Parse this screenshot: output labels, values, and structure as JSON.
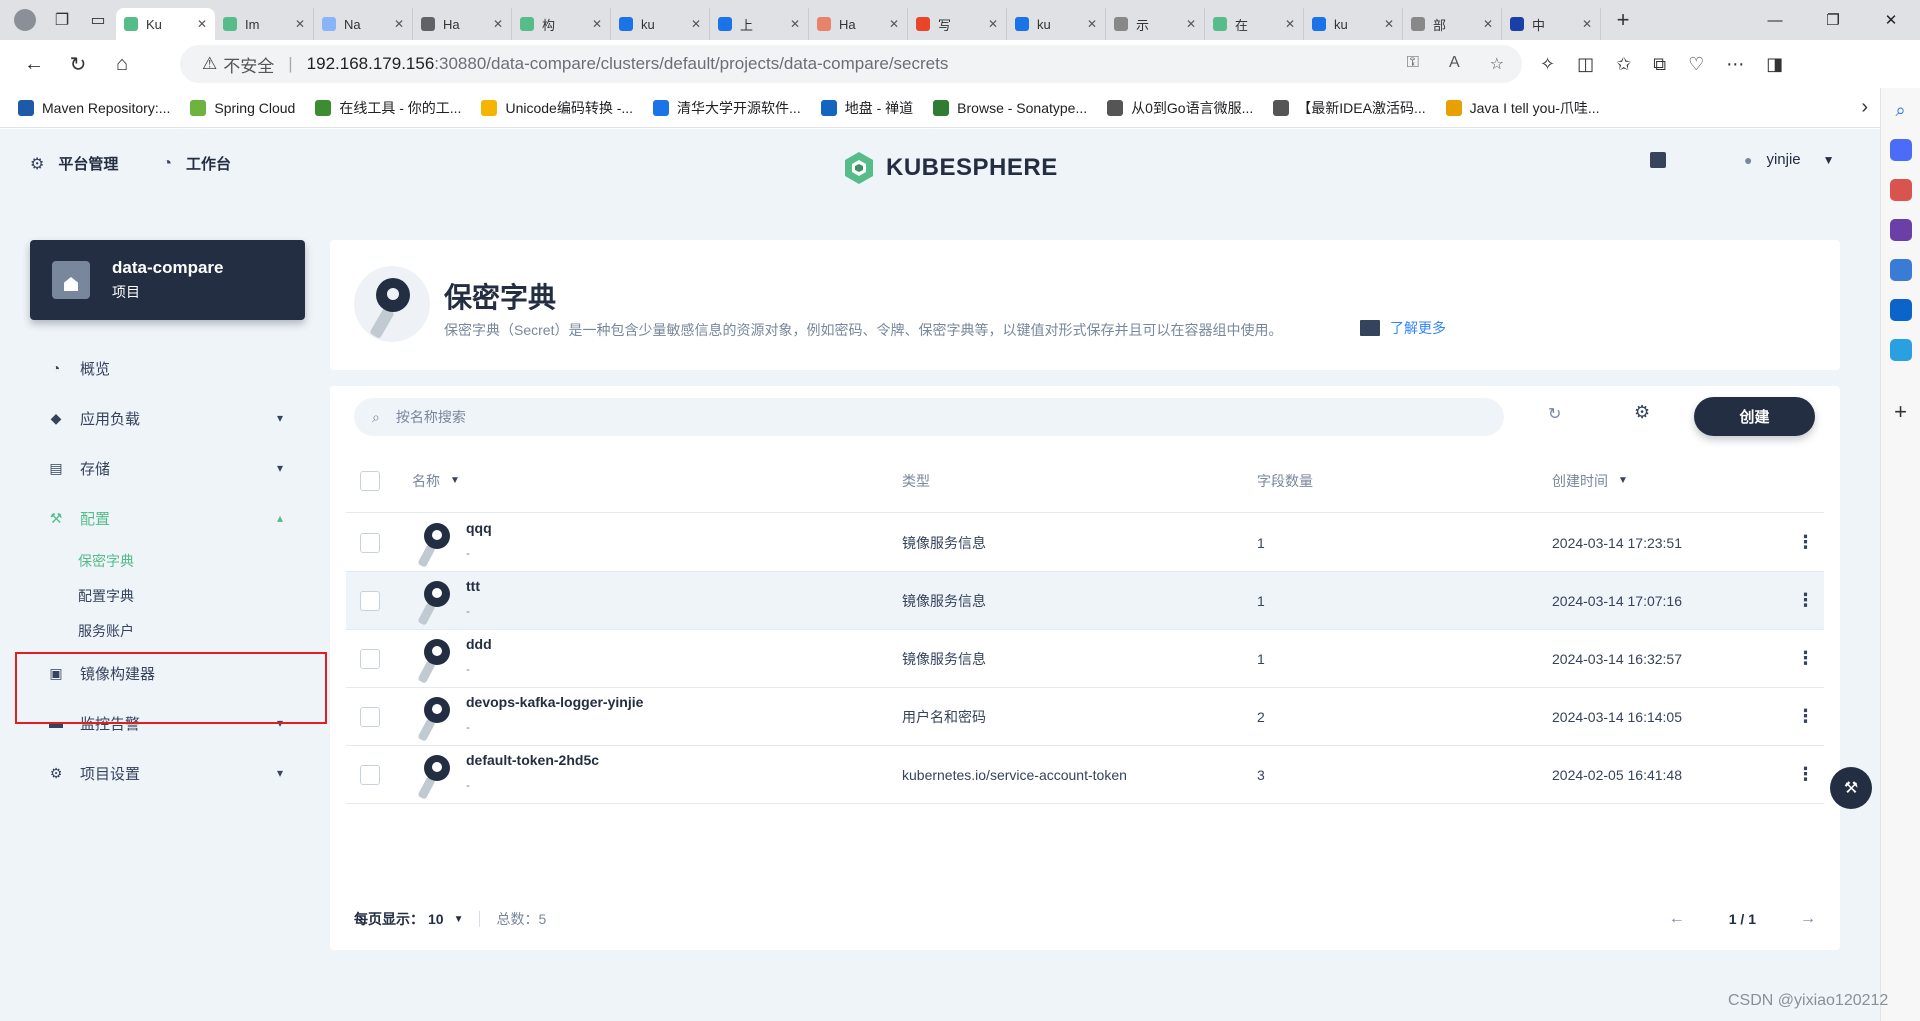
{
  "browser": {
    "tabs": [
      {
        "title": "Ku",
        "color": "#55bc8a",
        "active": true
      },
      {
        "title": "Im",
        "color": "#55bc8a",
        "active": false
      },
      {
        "title": "Na",
        "color": "#8ab4f8",
        "active": false
      },
      {
        "title": "Ha",
        "color": "#5f6368",
        "active": false
      },
      {
        "title": "构",
        "color": "#55bc8a",
        "active": false
      },
      {
        "title": "ku",
        "color": "#1a73e8",
        "active": false
      },
      {
        "title": "上",
        "color": "#1a73e8",
        "active": false
      },
      {
        "title": "Ha",
        "color": "#e8826a",
        "active": false
      },
      {
        "title": "写",
        "color": "#e8452a",
        "active": false
      },
      {
        "title": "ku",
        "color": "#1a73e8",
        "active": false
      },
      {
        "title": "示",
        "color": "#888888",
        "active": false
      },
      {
        "title": "在",
        "color": "#55bc8a",
        "active": false
      },
      {
        "title": "ku",
        "color": "#1a73e8",
        "active": false
      },
      {
        "title": "部",
        "color": "#888888",
        "active": false
      },
      {
        "title": "中",
        "color": "#1a3fa8",
        "active": false
      }
    ],
    "address": {
      "warning_label": "不安全",
      "host": "192.168.179.156",
      "path": ":30880/data-compare/clusters/default/projects/data-compare/secrets"
    },
    "bookmarks": [
      {
        "label": "Maven Repository:...",
        "color": "#1e5aa8"
      },
      {
        "label": "Spring Cloud",
        "color": "#6db33f"
      },
      {
        "label": "在线工具 - 你的工...",
        "color": "#3c8d2f"
      },
      {
        "label": "Unicode编码转换 -...",
        "color": "#f4b400"
      },
      {
        "label": "清华大学开源软件...",
        "color": "#1a73e8"
      },
      {
        "label": "地盘 - 禅道",
        "color": "#1565c0"
      },
      {
        "label": "Browse - Sonatype...",
        "color": "#2e7d32"
      },
      {
        "label": "从0到Go语言微服...",
        "color": "#555555"
      },
      {
        "label": "【最新IDEA激活码...",
        "color": "#555555"
      },
      {
        "label": "Java I tell you-爪哇...",
        "color": "#e8a000"
      }
    ]
  },
  "app": {
    "topnav": {
      "platform": "平台管理",
      "workbench": "工作台"
    },
    "logo_text": "KUBESPHERE",
    "user": "yinjie",
    "project": {
      "name": "data-compare",
      "type": "项目"
    },
    "menu": {
      "overview": "概览",
      "workloads": "应用负载",
      "storage": "存储",
      "config": "配置",
      "secrets": "保密字典",
      "configmaps": "配置字典",
      "service_accounts": "服务账户",
      "image_builder": "镜像构建器",
      "monitoring": "监控告警",
      "project_settings": "项目设置"
    },
    "banner": {
      "title": "保密字典",
      "description": "保密字典（Secret）是一种包含少量敏感信息的资源对象，例如密码、令牌、保密字典等，以键值对形式保存并且可以在容器组中使用。",
      "learn_more": "了解更多"
    },
    "toolbar": {
      "search_placeholder": "按名称搜索",
      "create": "创建"
    },
    "table": {
      "headers": {
        "name": "名称",
        "type": "类型",
        "field_count": "字段数量",
        "created": "创建时间"
      },
      "rows": [
        {
          "name": "qqq",
          "desc": "-",
          "type": "镜像服务信息",
          "count": "1",
          "created": "2024-03-14 17:23:51"
        },
        {
          "name": "ttt",
          "desc": "-",
          "type": "镜像服务信息",
          "count": "1",
          "created": "2024-03-14 17:07:16"
        },
        {
          "name": "ddd",
          "desc": "-",
          "type": "镜像服务信息",
          "count": "1",
          "created": "2024-03-14 16:32:57"
        },
        {
          "name": "devops-kafka-logger-yinjie",
          "desc": "-",
          "type": "用户名和密码",
          "count": "2",
          "created": "2024-03-14 16:14:05"
        },
        {
          "name": "default-token-2hd5c",
          "desc": "-",
          "type": "kubernetes.io/service-account-token",
          "count": "3",
          "created": "2024-02-05 16:41:48"
        }
      ]
    },
    "footer": {
      "per_page_label": "每页显示：",
      "per_page": "10",
      "total": "总数：5",
      "page": "1 / 1"
    },
    "colors": {
      "accent": "#55bc8a",
      "dark": "#242e42",
      "highlight_box": "#e02020"
    }
  },
  "watermark": "CSDN @yixiao120212"
}
